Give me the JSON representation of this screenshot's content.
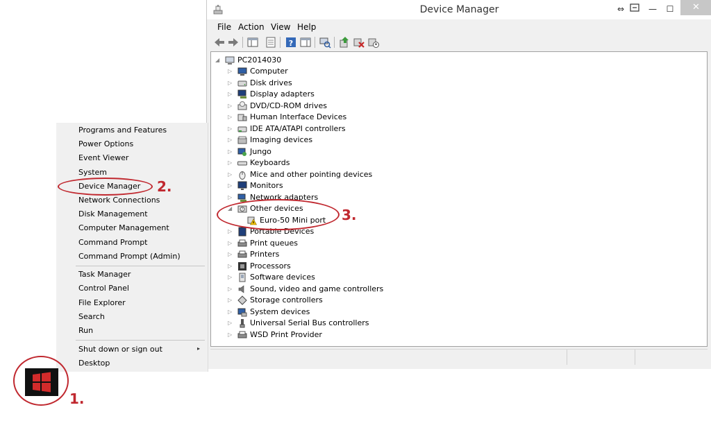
{
  "window": {
    "title": "Device Manager",
    "buttons": {
      "restore_glyph": "⇔",
      "minimize": "—",
      "maximize": "☐",
      "close": "✕"
    }
  },
  "menubar": [
    "File",
    "Action",
    "View",
    "Help"
  ],
  "toolbar": {
    "icons": [
      "back-icon",
      "forward-icon",
      "show-hide-console-tree-icon",
      "properties-icon",
      "help-icon",
      "action-pane-icon",
      "scan-hardware-icon",
      "update-driver-icon",
      "uninstall-icon",
      "disable-device-icon"
    ]
  },
  "tree": {
    "root": "PC2014030",
    "categories": [
      "Computer",
      "Disk drives",
      "Display adapters",
      "DVD/CD-ROM drives",
      "Human Interface Devices",
      "IDE ATA/ATAPI controllers",
      "Imaging devices",
      "Jungo",
      "Keyboards",
      "Mice and other pointing devices",
      "Monitors",
      "Network adapters",
      "Other devices",
      "Portable Devices",
      "Print queues",
      "Printers",
      "Processors",
      "Software devices",
      "Sound, video and game controllers",
      "Storage controllers",
      "System devices",
      "Universal Serial Bus controllers",
      "WSD Print Provider"
    ],
    "other_devices_child": "Euro-50 Mini port",
    "expanded_arrow": "◢",
    "collapsed_arrow": "▷"
  },
  "winx_menu": {
    "group1": [
      "Programs and Features",
      "Power Options",
      "Event Viewer",
      "System",
      "Device Manager",
      "Network Connections",
      "Disk Management",
      "Computer Management",
      "Command Prompt",
      "Command Prompt (Admin)"
    ],
    "group2": [
      "Task Manager",
      "Control Panel",
      "File Explorer",
      "Search",
      "Run"
    ],
    "group3": [
      "Shut down or sign out",
      "Desktop"
    ],
    "submenu_arrow": "▸"
  },
  "annotations": {
    "step1": "1.",
    "step2": "2.",
    "step3": "3."
  },
  "colors": {
    "annotation_red": "#c0282f",
    "windows_logo_red": "#d22b2b",
    "start_tile": "#111111"
  }
}
